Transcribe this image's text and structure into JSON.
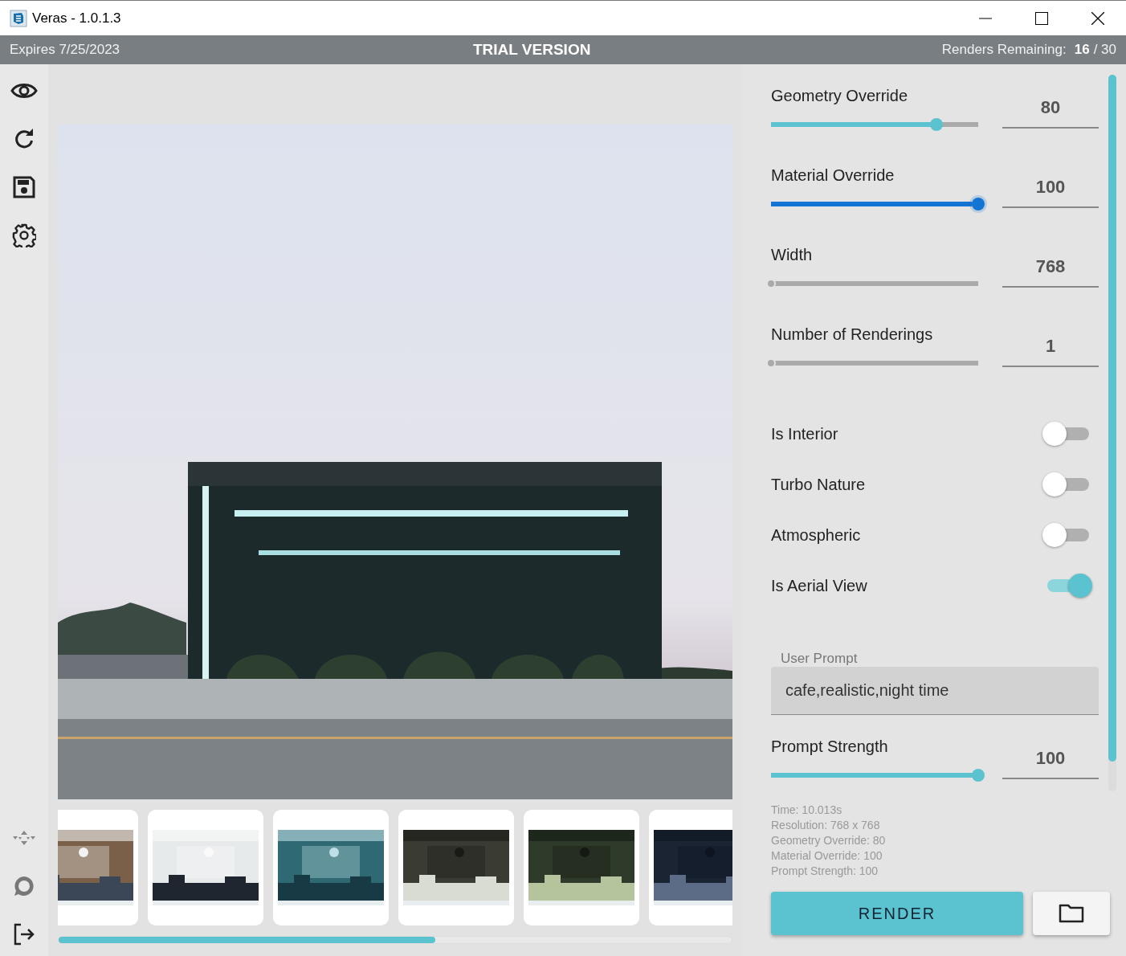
{
  "window": {
    "title": "Veras - 1.0.1.3"
  },
  "status_bar": {
    "expires": "Expires 7/25/2023",
    "center": "TRIAL VERSION",
    "renders_label": "Renders Remaining:",
    "renders_used": "16",
    "renders_total": "/ 30"
  },
  "thumbnail_scroll": {
    "level": 0.56
  },
  "sliders": [
    {
      "label": "Geometry Override",
      "level": 0.8,
      "focused": false,
      "value": "80"
    },
    {
      "label": "Material Override",
      "level": 1,
      "focused": true,
      "value": "100"
    },
    {
      "label": "Width",
      "level": 0,
      "focused": false,
      "value": "768"
    },
    {
      "label": "Number of Renderings",
      "level": 0,
      "focused": false,
      "value": "1"
    }
  ],
  "toggles": [
    {
      "label": "Is Interior",
      "on": false
    },
    {
      "label": "Turbo Nature",
      "on": false
    },
    {
      "label": "Atmospheric",
      "on": false
    },
    {
      "label": "Is Aerial View",
      "on": true
    }
  ],
  "user_prompt": {
    "label": "User Prompt",
    "value": "cafe,realistic,night time"
  },
  "prompt_strength": {
    "label": "Prompt Strength",
    "level": 1,
    "focused": false,
    "value": "100"
  },
  "render_info": [
    "Time: 10.013s",
    "Resolution: 768 x 768",
    "Geometry Override: 80",
    "Material Override: 100",
    "Prompt Strength: 100"
  ],
  "render_button": "RENDER"
}
